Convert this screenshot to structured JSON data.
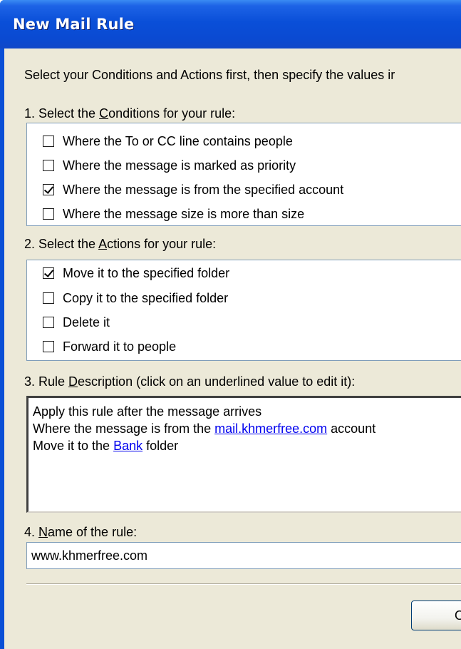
{
  "window": {
    "title": "New Mail Rule"
  },
  "instructions": "Select your Conditions and Actions first, then specify the values ir",
  "conditions": {
    "heading_pre": "1. Select the ",
    "heading_mnemonic": "C",
    "heading_post": "onditions for your rule:",
    "items": [
      {
        "label": "Where the To or CC line contains people",
        "checked": false
      },
      {
        "label": "Where the message is marked as priority",
        "checked": false
      },
      {
        "label": "Where the message is from the specified account",
        "checked": true
      },
      {
        "label": "Where the message size is more than size",
        "checked": false
      }
    ]
  },
  "actions": {
    "heading_pre": "2. Select the ",
    "heading_mnemonic": "A",
    "heading_post": "ctions for your rule:",
    "items": [
      {
        "label": "Move it to the specified folder",
        "checked": true
      },
      {
        "label": "Copy it to the specified folder",
        "checked": false
      },
      {
        "label": "Delete it",
        "checked": false
      },
      {
        "label": "Forward it to people",
        "checked": false
      }
    ]
  },
  "description": {
    "heading_pre": "3. Rule ",
    "heading_mnemonic": "D",
    "heading_post": "escription (click on an underlined value to edit it):",
    "line1": "Apply this rule after the message arrives",
    "line2_pre": "Where the message is from the ",
    "line2_link": "mail.khmerfree.com",
    "line2_post": " account",
    "line3_pre": "Move it to the ",
    "line3_link": "Bank",
    "line3_post": " folder"
  },
  "rule_name": {
    "heading_pre": "4. ",
    "heading_mnemonic": "N",
    "heading_post": "ame of the rule:",
    "value": "www.khmerfree.com"
  },
  "buttons": {
    "ok_partial": "O"
  },
  "colors": {
    "titlebar": "#0a4fd8",
    "dialog_bg": "#ece9d8",
    "link": "#0000ee",
    "field_border": "#7f9db9"
  }
}
